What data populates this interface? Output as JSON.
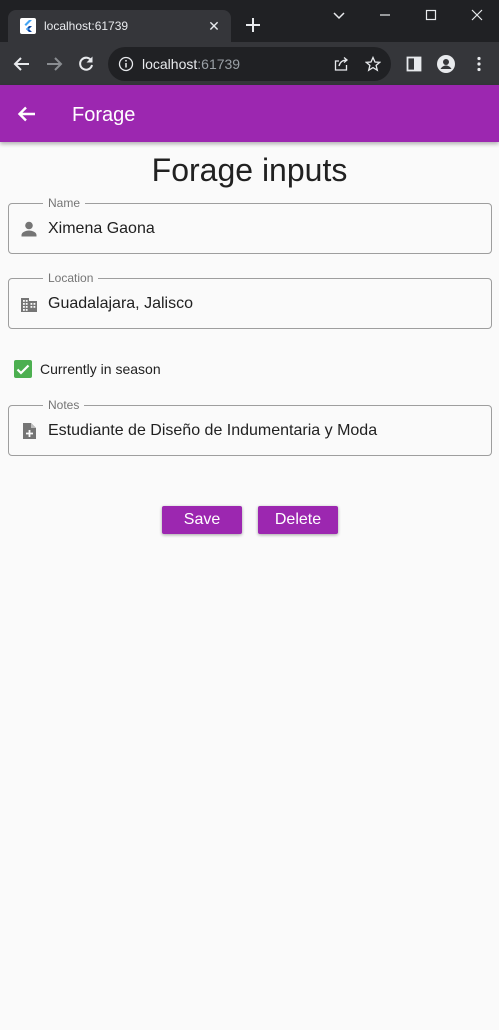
{
  "browser": {
    "tab_title": "localhost:61739",
    "url_host": "localhost",
    "url_port": ":61739"
  },
  "appbar": {
    "title": "Forage"
  },
  "form": {
    "heading": "Forage inputs",
    "name": {
      "label": "Name",
      "value": "Ximena Gaona",
      "icon": "person-icon"
    },
    "location": {
      "label": "Location",
      "value": "Guadalajara, Jalisco",
      "icon": "building-icon"
    },
    "in_season": {
      "label": "Currently in season",
      "checked": true
    },
    "notes": {
      "label": "Notes",
      "value": "Estudiante de Diseño de Indumentaria y Moda",
      "icon": "note-add-icon"
    },
    "save_label": "Save",
    "delete_label": "Delete"
  },
  "colors": {
    "primary": "#9c27b0",
    "checkbox": "#4caf50"
  }
}
